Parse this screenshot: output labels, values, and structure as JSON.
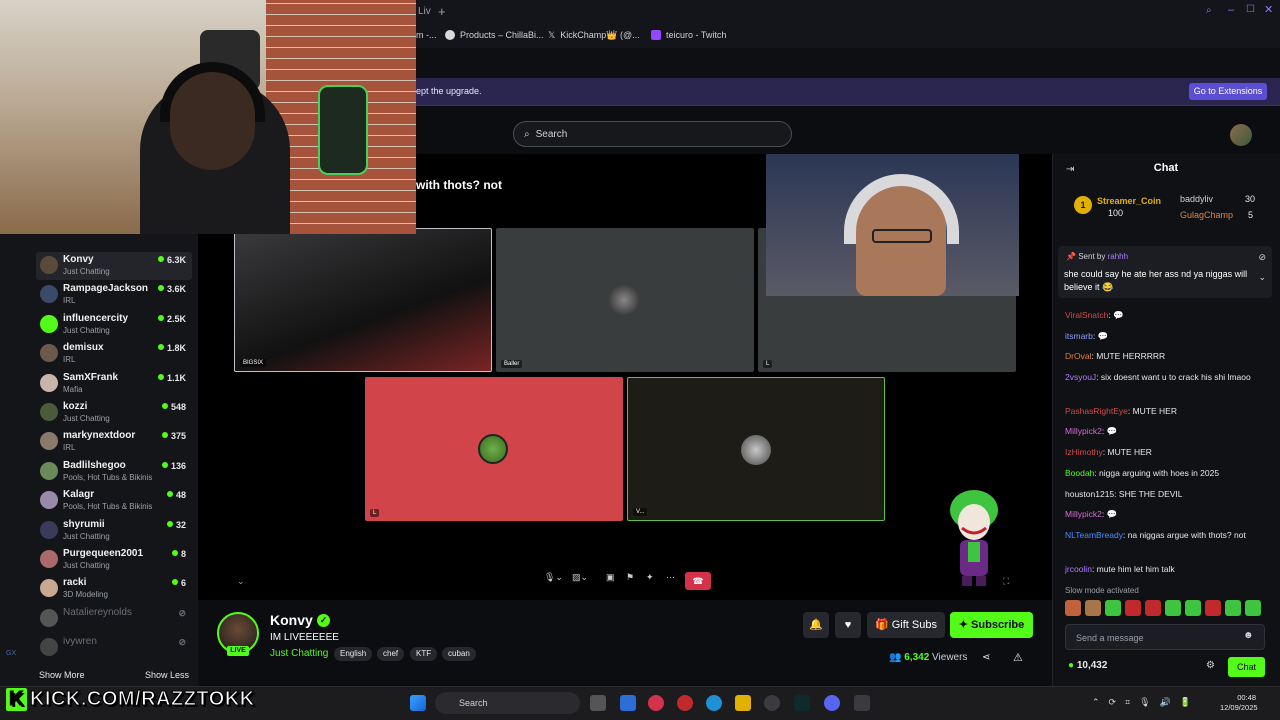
{
  "browser": {
    "tab_partial": "Liv",
    "bookmarks": [
      "m -...",
      "Products – ChillaBi...",
      "KickChamp👑 (@...",
      "teicuro - Twitch"
    ],
    "extension_notice": "ept the upgrade.",
    "extension_button": "Go to Extensions"
  },
  "header": {
    "search_placeholder": "Search"
  },
  "video": {
    "title_partial": "with thots? not",
    "tiles": [
      "BIGSIX",
      "Baller",
      "L",
      "L",
      "V..."
    ]
  },
  "sidebar": {
    "channels": [
      {
        "name": "Konvy",
        "category": "Just Chatting",
        "viewers": "6.3K"
      },
      {
        "name": "RampageJackson",
        "category": "IRL",
        "viewers": "3.6K"
      },
      {
        "name": "influencercity",
        "category": "Just Chatting",
        "viewers": "2.5K"
      },
      {
        "name": "demisux",
        "category": "IRL",
        "viewers": "1.8K"
      },
      {
        "name": "SamXFrank",
        "category": "Mafia",
        "viewers": "1.1K"
      },
      {
        "name": "kozzi",
        "category": "Just Chatting",
        "viewers": "548"
      },
      {
        "name": "markynextdoor",
        "category": "IRL",
        "viewers": "375"
      },
      {
        "name": "Badlilshegoo",
        "category": "Pools, Hot Tubs & Bikinis",
        "viewers": "136"
      },
      {
        "name": "Kalagr",
        "category": "Pools, Hot Tubs & Bikinis",
        "viewers": "48"
      },
      {
        "name": "shyrumii",
        "category": "Just Chatting",
        "viewers": "32"
      },
      {
        "name": "Purgequeen2001",
        "category": "Just Chatting",
        "viewers": "8"
      },
      {
        "name": "racki",
        "category": "3D Modeling",
        "viewers": "6"
      },
      {
        "name": "Nataliereynolds",
        "category": "",
        "viewers": ""
      },
      {
        "name": "ivywren",
        "category": "",
        "viewers": ""
      }
    ],
    "show_more": "Show More",
    "show_less": "Show Less"
  },
  "stream": {
    "channel_name": "Konvy",
    "title": "IM LIVEEEEEE",
    "category": "Just Chatting",
    "live_badge": "LIVE",
    "tags": [
      "English",
      "chef",
      "KTF",
      "cuban"
    ],
    "gift_subs": "Gift Subs",
    "subscribe": "Subscribe",
    "viewer_count": "6,342",
    "viewers_label": "Viewers"
  },
  "chat": {
    "title": "Chat",
    "leaderboard": [
      {
        "rank": "1",
        "name": "Streamer_Coin",
        "value": "100"
      },
      {
        "name": "baddyliv",
        "value": "30"
      },
      {
        "name": "GulagChamp",
        "value": "5"
      }
    ],
    "pinned_by_label": "Sent by",
    "pinned_by": "rahhh",
    "pinned_text": "she could say he ate her ass nd ya niggas will believe it 😂",
    "messages": [
      {
        "user": "ViralSnatch",
        "text": "",
        "color": "#d04a4a"
      },
      {
        "user": "itsmarb",
        "text": "",
        "color": "#8aa0ff"
      },
      {
        "user": "DrOval",
        "text": "MUTE HERRRRR",
        "color": "#e0823a"
      },
      {
        "user": "2vsyouJ",
        "text": "six doesnt want u to crack his shi lmaoo",
        "color": "#b07cff"
      },
      {
        "user": "PashasRightEye",
        "text": "MUTE HER",
        "color": "#d04a4a"
      },
      {
        "user": "Millypick2",
        "text": "",
        "color": "#d66bd0"
      },
      {
        "user": "IzHimothy",
        "text": "MUTE HER",
        "color": "#d04a4a"
      },
      {
        "user": "Boodah",
        "text": "nigga arguing with hoes in 2025",
        "color": "#53fc18"
      },
      {
        "user": "houston1215",
        "text": "SHE THE DEVIL",
        "color": "#e8e8ea"
      },
      {
        "user": "Millypick2",
        "text": "",
        "color": "#d66bd0"
      },
      {
        "user": "NLTeamBready",
        "text": "na niggas argue with thots? not",
        "color": "#4a8cff"
      },
      {
        "user": "jrcoolin",
        "text": "mute him let him talk",
        "color": "#b07cff"
      }
    ],
    "slow_mode": "Slow mode activated",
    "input_placeholder": "Send a message",
    "kicks_balance": "10,432",
    "send_button": "Chat"
  },
  "watermark": {
    "k": "K",
    "text": "KICK.COM/RAZZTOKK"
  },
  "taskbar": {
    "search": "Search",
    "time": "00:48",
    "date": "12/09/2025"
  },
  "colors": {
    "accent": "#53fc18",
    "live_red": "#d3334a",
    "extension_bar": "#2a2650"
  }
}
